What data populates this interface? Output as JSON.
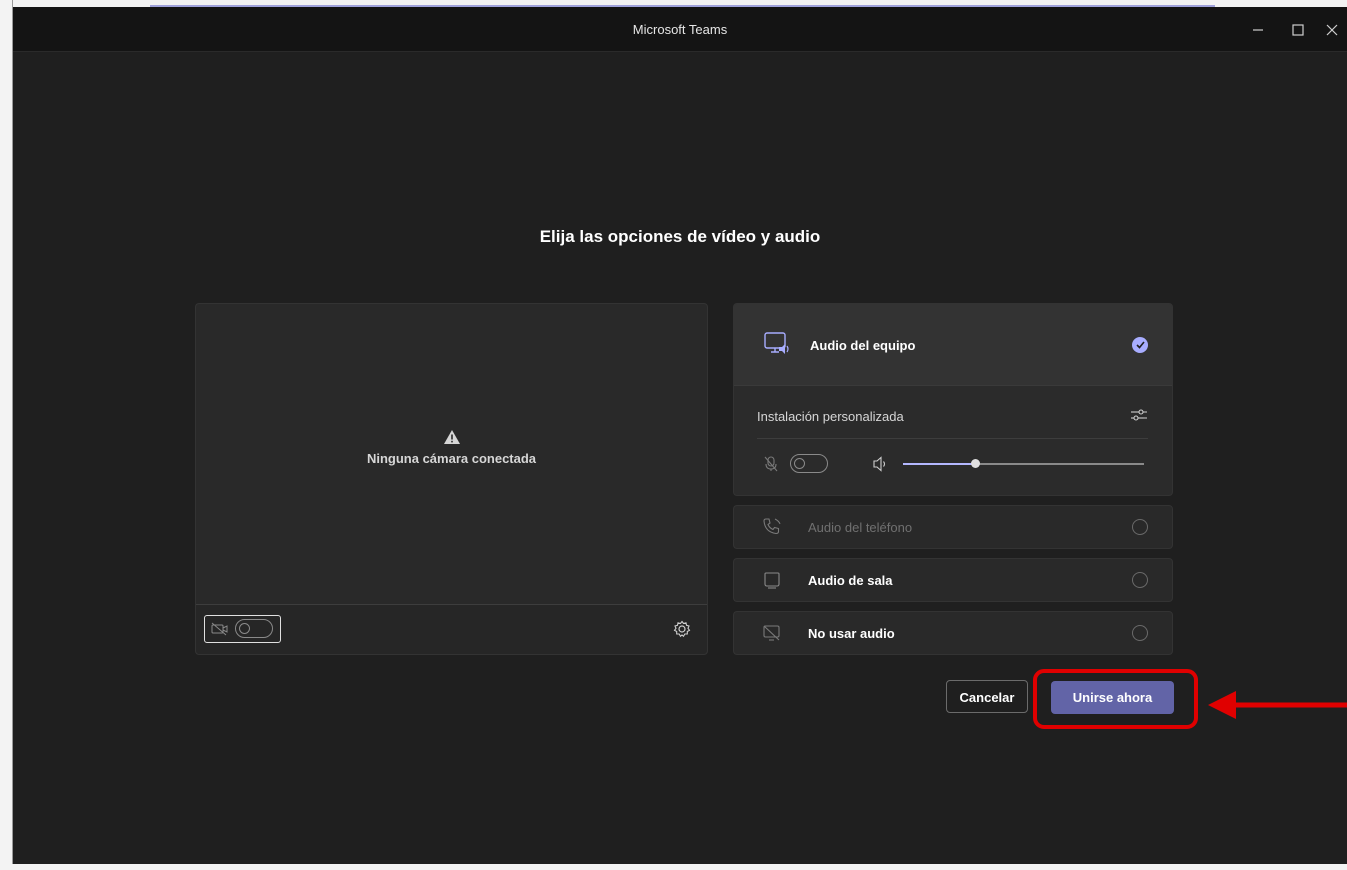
{
  "window": {
    "title": "Microsoft Teams",
    "controls": [
      "minimize-icon",
      "maximize-icon",
      "close-icon"
    ]
  },
  "prejoin": {
    "heading": "Elija las opciones de vídeo y audio",
    "video": {
      "no_camera_message": "Ninguna cámara conectada",
      "camera_toggle_on": false,
      "icons": [
        "warning-icon",
        "camera-off-icon",
        "gear-icon"
      ]
    },
    "audio": {
      "selected_option": {
        "label": "Audio del equipo",
        "icon": "computer-audio-icon",
        "selected": true
      },
      "custom_setup_label": "Instalación personalizada",
      "mic_toggle_on": false,
      "speaker_volume": 0.3,
      "options": [
        {
          "label": "Audio del teléfono",
          "icon": "phone-audio-icon",
          "disabled": true
        },
        {
          "label": "Audio de sala",
          "icon": "room-audio-icon",
          "disabled": false
        },
        {
          "label": "No usar audio",
          "icon": "no-audio-icon",
          "disabled": false
        }
      ]
    },
    "buttons": {
      "cancel": "Cancelar",
      "join": "Unirse ahora"
    }
  },
  "colors": {
    "accent": "#6264a7",
    "check": "#a8adff",
    "annotation": "#e00000",
    "background": "#1f1f1f"
  }
}
